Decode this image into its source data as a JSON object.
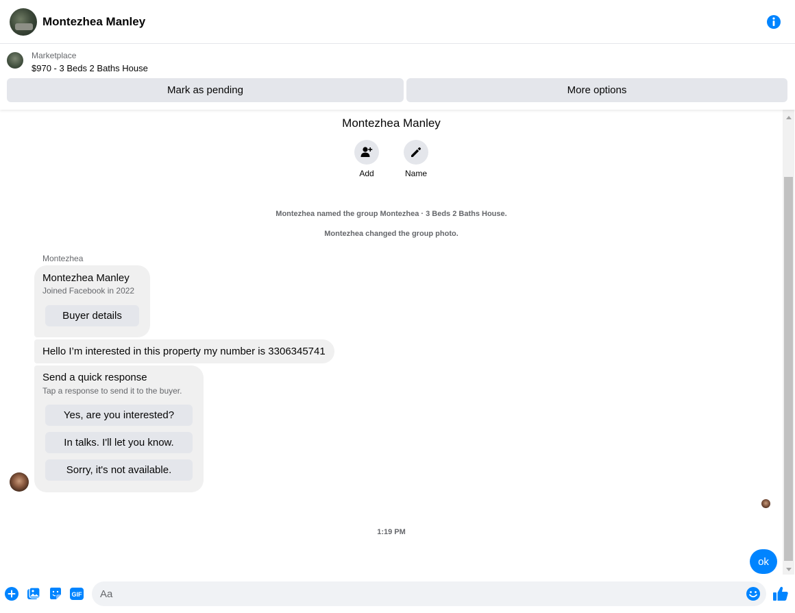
{
  "header": {
    "name": "Montezhea Manley"
  },
  "marketplace": {
    "label": "Marketplace",
    "listing_title": "$970 - 3 Beds 2 Baths House",
    "mark_pending_label": "Mark as pending",
    "more_options_label": "More options"
  },
  "conversation": {
    "title": "Montezhea Manley",
    "actions": {
      "add_label": "Add",
      "name_label": "Name"
    },
    "system_messages": [
      "Montezhea named the group Montezhea · 3 Beds 2 Baths House.",
      "Montezhea changed the group photo."
    ],
    "sender_name": "Montezhea",
    "profile_card": {
      "name": "Montezhea Manley",
      "joined": "Joined Facebook in 2022",
      "button_label": "Buyer details"
    },
    "message_text": "Hello I’m interested in this property my number is 3306345741",
    "quick_response": {
      "title": "Send a quick response",
      "subtitle": "Tap a response to send it to the buyer.",
      "options": [
        "Yes, are you interested?",
        "In talks. I'll let you know.",
        "Sorry, it's not available."
      ]
    },
    "timestamp": "1:19 PM",
    "my_message": "ok"
  },
  "composer": {
    "placeholder": "Aa"
  },
  "colors": {
    "accent": "#0084ff",
    "bubble_gray": "#f0f0f0",
    "button_gray": "#e4e6eb",
    "secondary_text": "#65676b"
  },
  "icons": {
    "header": [
      "info-icon"
    ],
    "actions": [
      "add-person-icon",
      "pencil-icon"
    ],
    "composer": [
      "plus-icon",
      "photo-icon",
      "sticker-icon",
      "gif-icon",
      "emoji-icon",
      "thumbs-up-icon"
    ]
  }
}
